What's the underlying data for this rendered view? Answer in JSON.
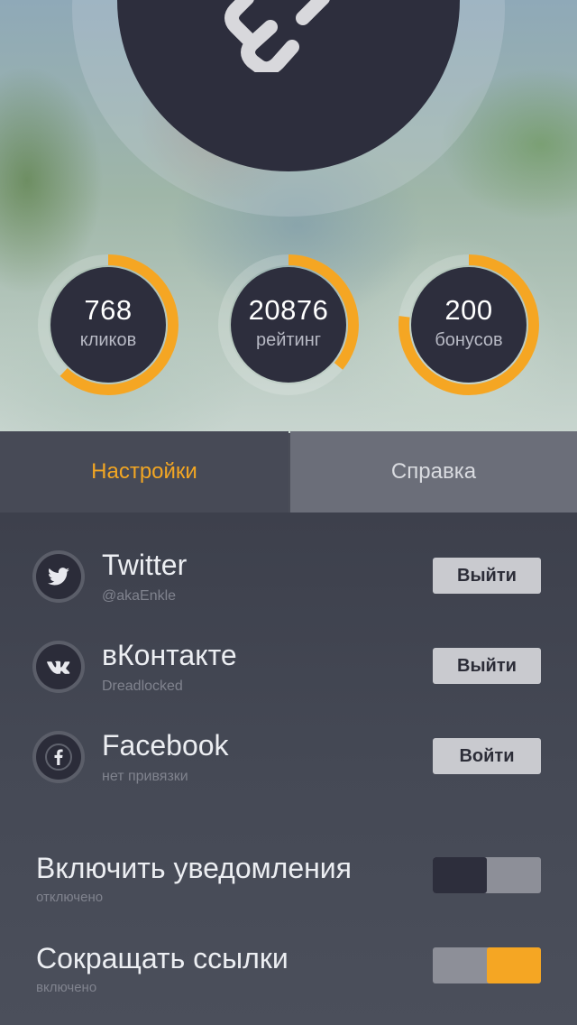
{
  "hero": {
    "logo_icon": "link-icon"
  },
  "stats": [
    {
      "value": "768",
      "label": "кликов",
      "progress": 0.62,
      "color": "#f5a623"
    },
    {
      "value": "20876",
      "label": "рейтинг",
      "progress": 0.36,
      "color": "#f5a623"
    },
    {
      "value": "200",
      "label": "бонусов",
      "progress": 0.77,
      "color": "#f5a623"
    }
  ],
  "tabs": [
    {
      "label": "Настройки",
      "active": true
    },
    {
      "label": "Справка",
      "active": false
    }
  ],
  "accounts": [
    {
      "name": "Twitter",
      "sub": "@akaEnkle",
      "button": "Выйти",
      "icon": "twitter-icon"
    },
    {
      "name": "вКонтакте",
      "sub": "Dreadlocked",
      "button": "Выйти",
      "icon": "vk-icon"
    },
    {
      "name": "Facebook",
      "sub": "нет привязки",
      "button": "Войти",
      "icon": "facebook-icon"
    }
  ],
  "settings": [
    {
      "title": "Включить уведомления",
      "status": "отключено",
      "on": false
    },
    {
      "title": "Сокращать ссылки",
      "status": "включено",
      "on": true
    }
  ],
  "colors": {
    "accent": "#f5a623",
    "dark": "#2d2e3d",
    "tab_active_text": "#f2a623"
  }
}
